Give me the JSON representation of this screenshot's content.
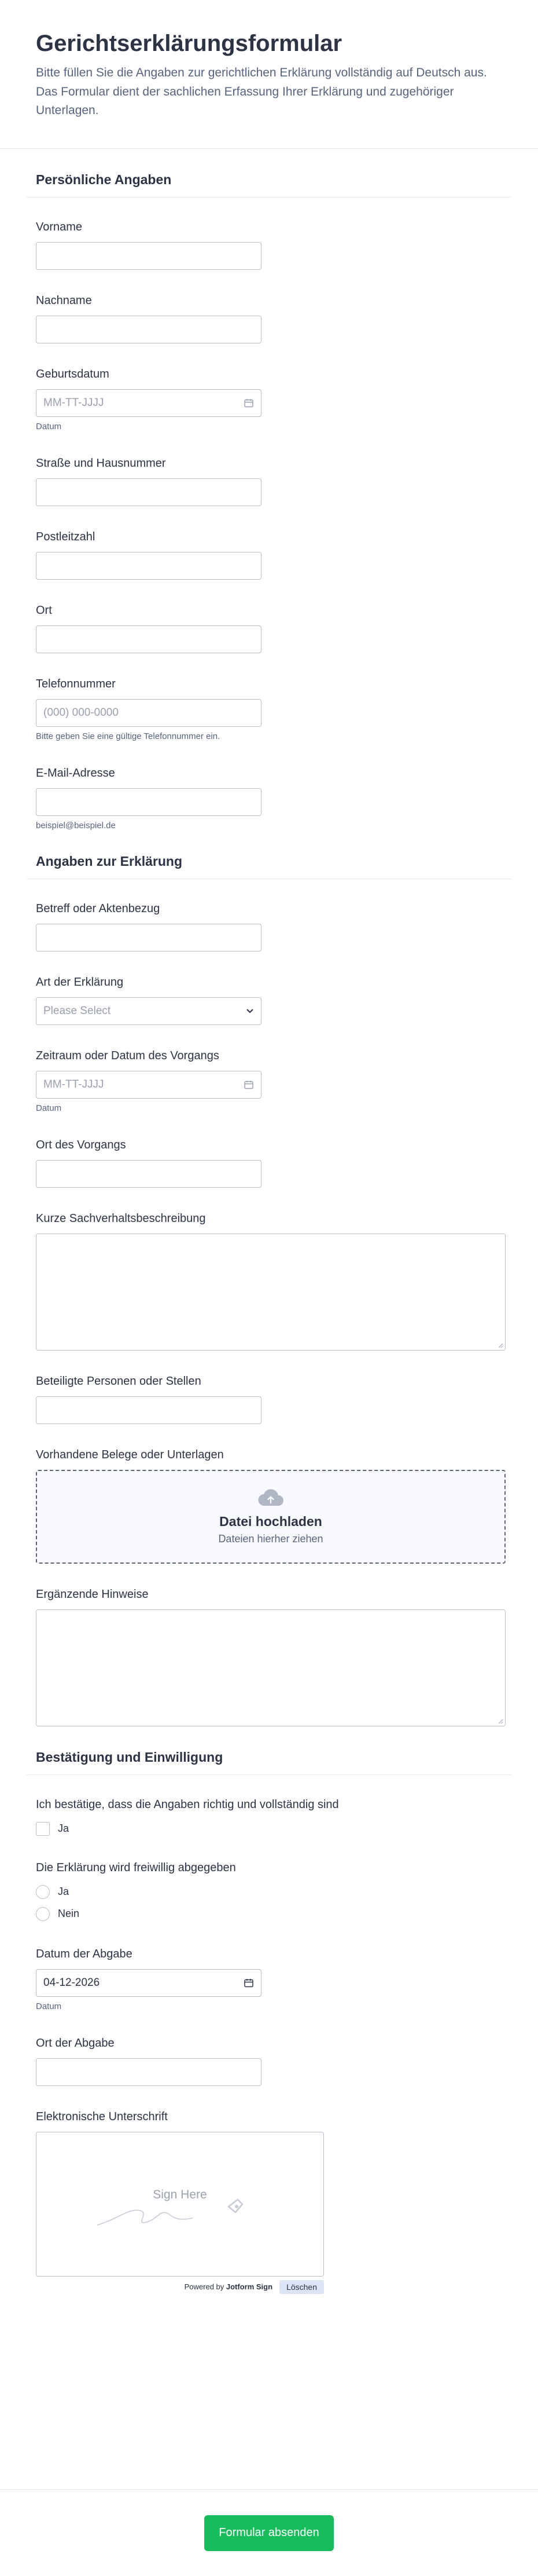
{
  "header": {
    "title": "Gerichtserklärungsformular",
    "description": "Bitte füllen Sie die Angaben zur gerichtlichen Erklärung vollständig auf Deutsch aus. Das Formular dient der sachlichen Erfassung Ihrer Erklärung und zugehöriger Unterlagen."
  },
  "sections": {
    "personal": "Persönliche Angaben",
    "declaration": "Angaben zur Erklärung",
    "confirmation": "Bestätigung und Einwilligung"
  },
  "fields": {
    "vorname": {
      "label": "Vorname",
      "value": ""
    },
    "nachname": {
      "label": "Nachname",
      "value": ""
    },
    "geburtsdatum": {
      "label": "Geburtsdatum",
      "placeholder": "MM-TT-JJJJ",
      "sub": "Datum"
    },
    "strasse": {
      "label": "Straße und Hausnummer",
      "value": ""
    },
    "plz": {
      "label": "Postleitzahl",
      "value": ""
    },
    "ort": {
      "label": "Ort",
      "value": ""
    },
    "telefon": {
      "label": "Telefonnummer",
      "placeholder": "(000) 000-0000",
      "sub": "Bitte geben Sie eine gültige Telefonnummer ein."
    },
    "email": {
      "label": "E-Mail-Adresse",
      "value": "",
      "sub": "beispiel@beispiel.de"
    },
    "betreff": {
      "label": "Betreff oder Aktenbezug",
      "value": ""
    },
    "art": {
      "label": "Art der Erklärung",
      "placeholder": "Please Select"
    },
    "zeitraum": {
      "label": "Zeitraum oder Datum des Vorgangs",
      "placeholder": "MM-TT-JJJJ",
      "sub": "Datum"
    },
    "ort_vorgang": {
      "label": "Ort des Vorgangs",
      "value": ""
    },
    "sachverhalt": {
      "label": "Kurze Sachverhaltsbeschreibung"
    },
    "beteiligte": {
      "label": "Beteiligte Personen oder Stellen",
      "value": ""
    },
    "belege": {
      "label": "Vorhandene Belege oder Unterlagen",
      "upload_title": "Datei hochladen",
      "upload_sub": "Dateien hierher ziehen"
    },
    "hinweise": {
      "label": "Ergänzende Hinweise"
    },
    "bestaetigung": {
      "label": "Ich bestätige, dass die Angaben richtig und vollständig sind",
      "option": "Ja"
    },
    "freiwillig": {
      "label": "Die Erklärung wird freiwillig abgegeben",
      "options": [
        "Ja",
        "Nein"
      ]
    },
    "datum_abgabe": {
      "label": "Datum der Abgabe",
      "value": "04-12-2026",
      "sub": "Datum"
    },
    "ort_abgabe": {
      "label": "Ort der Abgabe",
      "value": ""
    },
    "unterschrift": {
      "label": "Elektronische Unterschrift",
      "placeholder": "Sign Here",
      "powered_prefix": "Powered by",
      "powered_brand": "Jotform Sign",
      "clear": "Löschen"
    }
  },
  "submit": {
    "label": "Formular absenden"
  },
  "colors": {
    "submit": "#18bd5b",
    "text": "#2c3345",
    "muted": "#57647e",
    "border": "#b8bdc9"
  }
}
